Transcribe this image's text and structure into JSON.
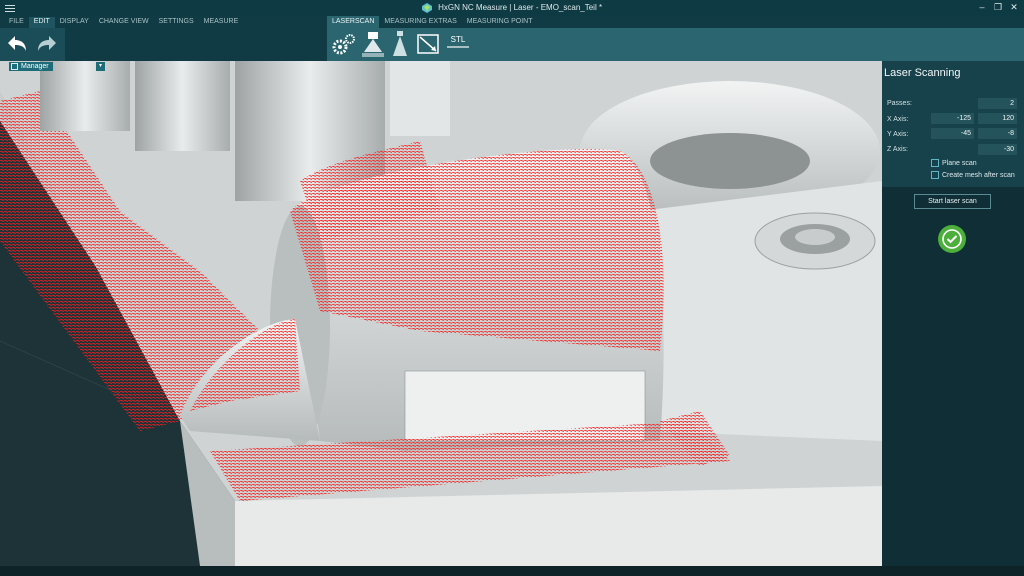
{
  "title": "HxGN NC Measure | Laser - EMO_scan_Teil *",
  "menu": [
    "FILE",
    "EDIT",
    "DISPLAY",
    "CHANGE VIEW",
    "SETTINGS",
    "MEASURE"
  ],
  "menu_active": "EDIT",
  "context_tabs": [
    "LASERSCAN",
    "MEASURING EXTRAS",
    "MEASURING POINT"
  ],
  "context_active": "LASERSCAN",
  "toolbar": {
    "stl_label": "STL"
  },
  "viewport": {
    "manager_label": "Manager"
  },
  "panel": {
    "title": "Laser Scanning",
    "passes_label": "Passes:",
    "passes": "2",
    "x_label": "X Axis:",
    "x_min": "-125",
    "x_max": "120",
    "y_label": "Y Axis:",
    "y_min": "-45",
    "y_max": "-8",
    "z_label": "Z Axis:",
    "z_val": "-30",
    "plane_scan": "Plane scan",
    "create_mesh": "Create mesh after scan",
    "start_button": "Start laser scan"
  },
  "colors": {
    "accent": "#2b6570",
    "scan": "#ff1a1a",
    "ok": "#4caf3c"
  }
}
